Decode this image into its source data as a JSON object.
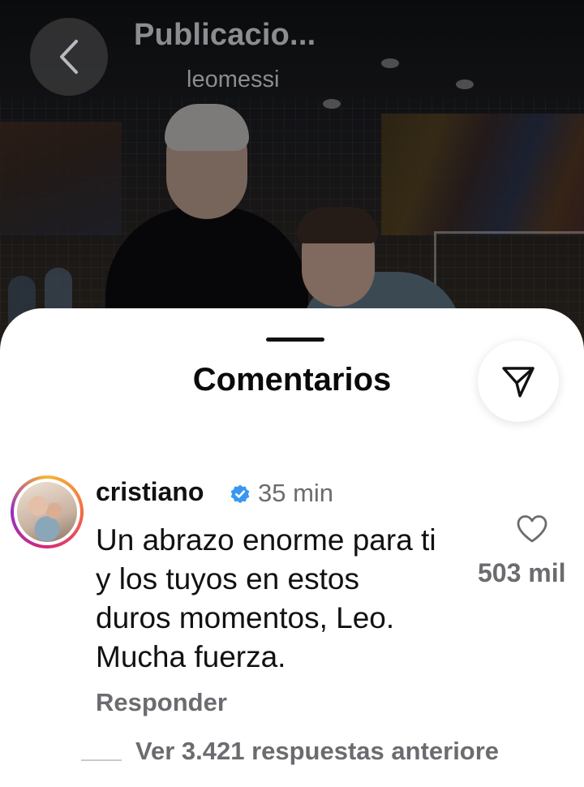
{
  "header": {
    "title": "Publicacio...",
    "subtitle": "leomessi",
    "back_icon": "chevron-left-icon"
  },
  "sheet": {
    "title": "Comentarios",
    "share_icon": "send-icon"
  },
  "comment": {
    "username": "cristiano",
    "verified_icon": "verified-badge-icon",
    "verified_color": "#3897f0",
    "time": "35 min",
    "lines": [
      "Un abrazo enorme para ti",
      "y los tuyos en estos",
      "duros momentos, Leo.",
      "Mucha fuerza."
    ],
    "like_icon": "heart-icon",
    "like_count": "503 mil",
    "reply_label": "Responder",
    "view_replies_label": "Ver 3.421 respuestas anteriore"
  },
  "colors": {
    "accent_text": "#111111",
    "muted_text": "#6b6c70",
    "story_ring": [
      "#f7b733",
      "#f36b45",
      "#d62976",
      "#962fbf"
    ]
  }
}
